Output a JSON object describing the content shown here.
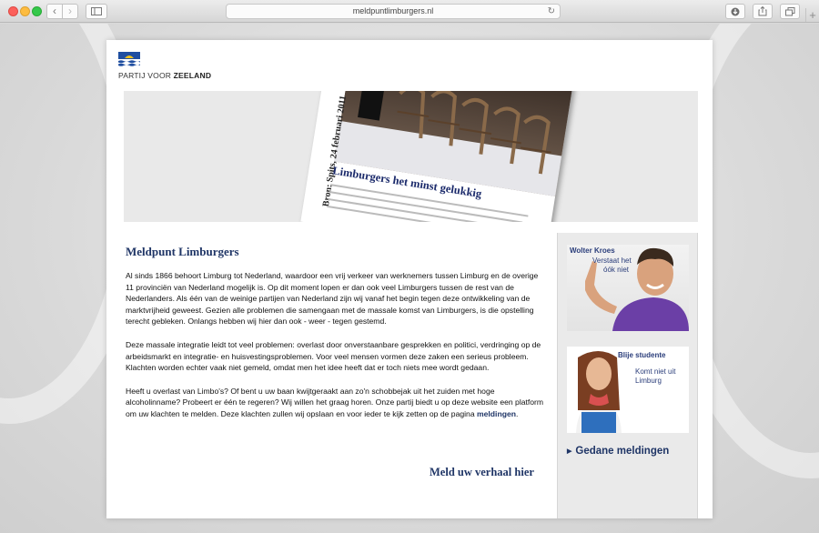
{
  "browser": {
    "url": "meldpuntlimburgers.nl",
    "back_icon": "chevron-left-icon",
    "forward_icon": "chevron-right-icon",
    "reload_icon": "reload-icon",
    "new_tab_label": "+"
  },
  "logo": {
    "text_part1": "PARTIJ VOOR",
    "text_part2": "ZEELAND"
  },
  "banner": {
    "source_caption": "Bron: Spits, 24 februari 2011",
    "headline": "Limburgers het minst gelukkig"
  },
  "main": {
    "title": "Meldpunt Limburgers",
    "paragraph1": "Al sinds 1866 behoort Limburg tot Nederland, waardoor een vrij verkeer van werknemers tussen Limburg en de overige 11 provinciën van Nederland mogelijk is. Op dit moment lopen er dan ook veel Limburgers tussen de rest van de Nederlanders. Als één van de weinige partijen van Nederland zijn wij vanaf het begin tegen deze ontwikkeling van de marktvrijheid geweest. Gezien alle problemen die samengaan met de massale komst van Limburgers, is die opstelling terecht gebleken. Onlangs hebben wij hier dan ook - weer - tegen gestemd.",
    "paragraph2": "Deze massale integratie leidt tot veel problemen: overlast door onverstaanbare gesprekken en politici, verdringing op de arbeidsmarkt en integratie- en huisvestingsproblemen. Voor veel mensen vormen deze zaken een serieus probleem. Klachten worden echter vaak niet gemeld, omdat men het idee heeft dat er toch niets mee wordt gedaan.",
    "paragraph3": "Heeft u overlast van Limbo's? Of bent u uw baan kwijtgeraakt aan zo'n schobbejak uit het zuiden met hoge alcoholinname? Probeert er één te regeren? Wij willen het graag horen. Onze partij biedt u op deze website een platform om uw klachten te melden. Deze klachten zullen wij opslaan en voor ieder te kijk zetten op de pagina",
    "paragraph3_link": "meldingen",
    "paragraph3_end": ".",
    "cta": "Meld uw verhaal hier"
  },
  "sidebar": {
    "ad1_title": "Wolter Kroes",
    "ad1_sub1": "Verstaat het",
    "ad1_sub2": "óók niet",
    "ad2_title": "Blije studente",
    "ad2_sub1": "Komt niet uit",
    "ad2_sub2": "Limburg",
    "gedane_label": "Gedane meldingen"
  }
}
